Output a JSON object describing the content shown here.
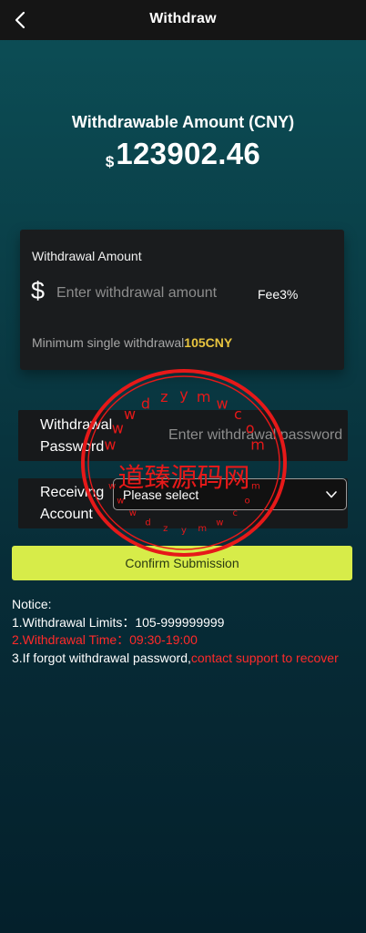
{
  "header": {
    "title": "Withdraw",
    "back_icon": "chevron-left-icon"
  },
  "balance": {
    "label": "Withdrawable Amount (CNY)",
    "currency_symbol": "$",
    "value": "123902.46"
  },
  "amount_card": {
    "title": "Withdrawal Amount",
    "currency_icon": "$",
    "input_placeholder": "Enter withdrawal amount",
    "input_value": "",
    "fee_label": "Fee3%",
    "min_prefix": "Minimum single withdrawal",
    "min_value": "105CNY"
  },
  "password_row": {
    "label_line1": "Withdrawal",
    "label_line2": "Password",
    "placeholder": "Enter withdrawal password",
    "value": ""
  },
  "account_row": {
    "label_line1": "Receiving",
    "label_line2": "Account",
    "selected": "Please select",
    "chevron_icon": "chevron-down-icon"
  },
  "submit": {
    "label": "Confirm Submission"
  },
  "notice": {
    "title": "Notice:",
    "line1": "1.Withdrawal Limits：105-999999999",
    "line2": "2.Withdrawal Time：09:30-19:00",
    "line3_prefix": "3.If forgot withdrawal password,",
    "line3_link": "contact support to recover"
  },
  "watermark": {
    "center_text": "道臻源码网",
    "ring_text": "wwwdzymwcom",
    "color": "#e61919"
  },
  "colors": {
    "accent": "#d7ec49",
    "highlight": "#e9c53f",
    "danger": "#ff2a2a",
    "bar": "#151515"
  }
}
